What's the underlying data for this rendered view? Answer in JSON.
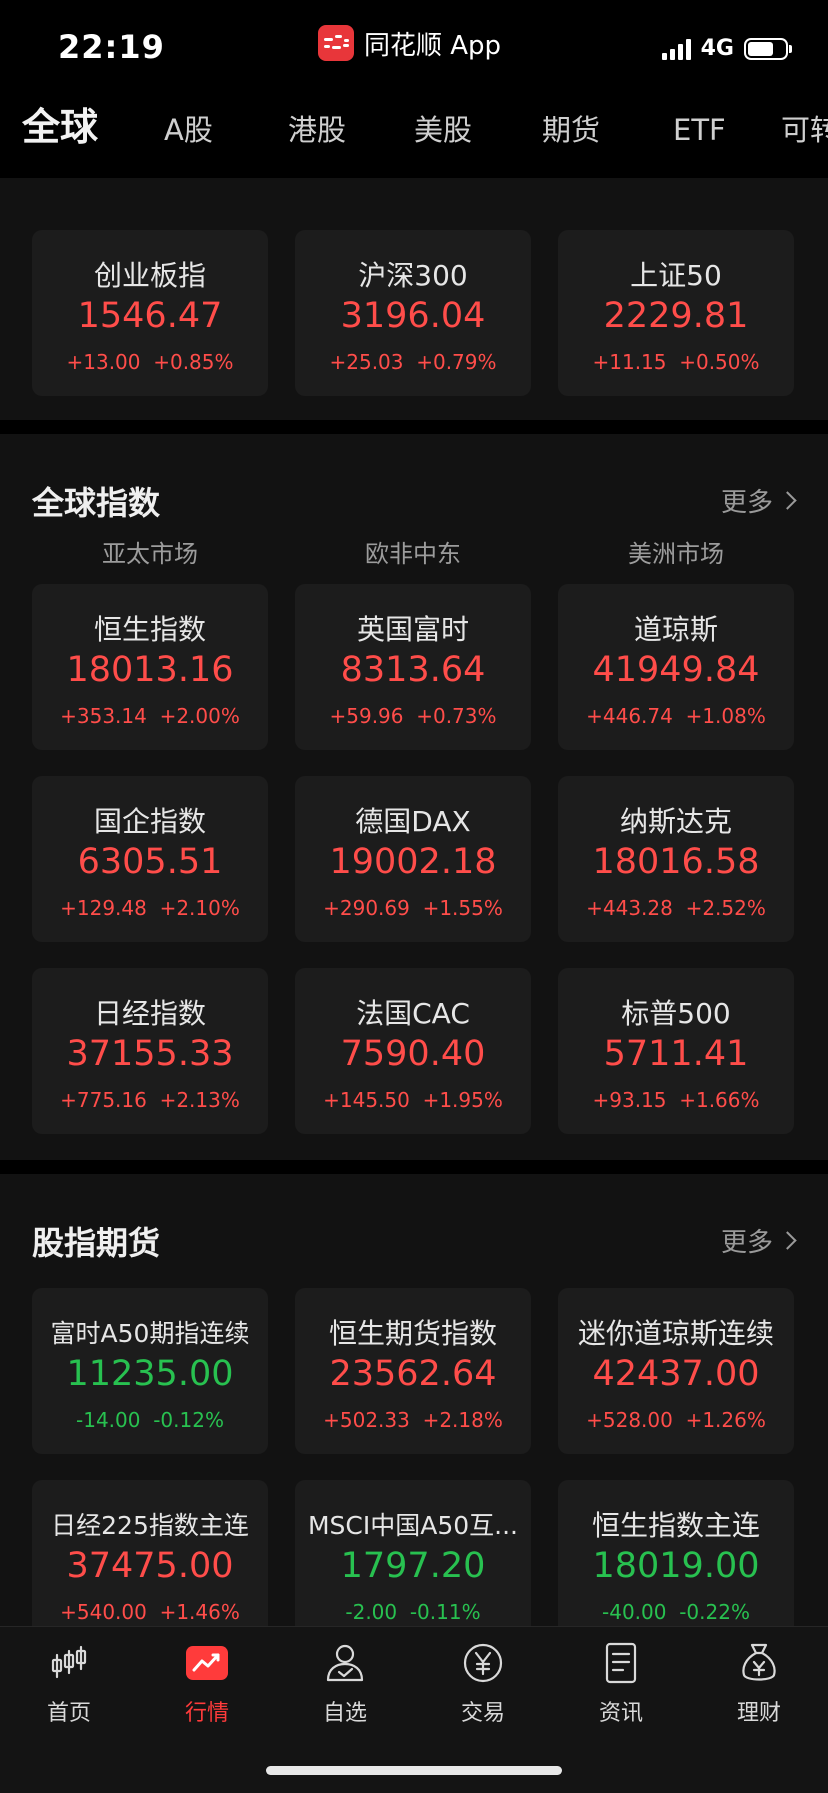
{
  "status_bar": {
    "time": "22:19",
    "app_name": "同花顺 App",
    "network": "4G",
    "battery_level": 0.7
  },
  "top_tabs": [
    "全球",
    "A股",
    "港股",
    "美股",
    "期货",
    "ETF",
    "可转"
  ],
  "a_share_indices": [
    {
      "name": "创业板指",
      "value": "1546.47",
      "change": "+13.00",
      "pct": "+0.85%",
      "trend": "up"
    },
    {
      "name": "沪深300",
      "value": "3196.04",
      "change": "+25.03",
      "pct": "+0.79%",
      "trend": "up"
    },
    {
      "name": "上证50",
      "value": "2229.81",
      "change": "+11.15",
      "pct": "+0.50%",
      "trend": "up"
    }
  ],
  "global_indices": {
    "title": "全球指数",
    "more": "更多",
    "regions": [
      "亚太市场",
      "欧非中东",
      "美洲市场"
    ],
    "cards": [
      {
        "name": "恒生指数",
        "value": "18013.16",
        "change": "+353.14",
        "pct": "+2.00%",
        "trend": "up"
      },
      {
        "name": "英国富时",
        "value": "8313.64",
        "change": "+59.96",
        "pct": "+0.73%",
        "trend": "up"
      },
      {
        "name": "道琼斯",
        "value": "41949.84",
        "change": "+446.74",
        "pct": "+1.08%",
        "trend": "up"
      },
      {
        "name": "国企指数",
        "value": "6305.51",
        "change": "+129.48",
        "pct": "+2.10%",
        "trend": "up"
      },
      {
        "name": "德国DAX",
        "value": "19002.18",
        "change": "+290.69",
        "pct": "+1.55%",
        "trend": "up"
      },
      {
        "name": "纳斯达克",
        "value": "18016.58",
        "change": "+443.28",
        "pct": "+2.52%",
        "trend": "up"
      },
      {
        "name": "日经指数",
        "value": "37155.33",
        "change": "+775.16",
        "pct": "+2.13%",
        "trend": "up"
      },
      {
        "name": "法国CAC",
        "value": "7590.40",
        "change": "+145.50",
        "pct": "+1.95%",
        "trend": "up"
      },
      {
        "name": "标普500",
        "value": "5711.41",
        "change": "+93.15",
        "pct": "+1.66%",
        "trend": "up"
      }
    ]
  },
  "index_futures": {
    "title": "股指期货",
    "more": "更多",
    "cards": [
      {
        "name": "富时A50期指连续",
        "value": "11235.00",
        "change": "-14.00",
        "pct": "-0.12%",
        "trend": "down"
      },
      {
        "name": "恒生期货指数",
        "value": "23562.64",
        "change": "+502.33",
        "pct": "+2.18%",
        "trend": "up"
      },
      {
        "name": "迷你道琼斯连续",
        "value": "42437.00",
        "change": "+528.00",
        "pct": "+1.26%",
        "trend": "up"
      },
      {
        "name": "日经225指数主连",
        "value": "37475.00",
        "change": "+540.00",
        "pct": "+1.46%",
        "trend": "up"
      },
      {
        "name": "MSCI中国A50互...",
        "value": "1797.20",
        "change": "-2.00",
        "pct": "-0.11%",
        "trend": "down"
      },
      {
        "name": "恒生指数主连",
        "value": "18019.00",
        "change": "-40.00",
        "pct": "-0.22%",
        "trend": "down"
      }
    ]
  },
  "bottom_tabs": [
    {
      "label": "首页",
      "icon": "candlestick-icon"
    },
    {
      "label": "行情",
      "icon": "market-chart-icon"
    },
    {
      "label": "自选",
      "icon": "watchlist-person-icon"
    },
    {
      "label": "交易",
      "icon": "yen-coin-icon"
    },
    {
      "label": "资讯",
      "icon": "news-document-icon"
    },
    {
      "label": "理财",
      "icon": "money-bag-icon"
    }
  ],
  "active_bottom_tab": "行情",
  "colors": {
    "up": "#ff4d4a",
    "down": "#28c150",
    "accent": "#e8363a",
    "background": "#000000",
    "card": "#1c1c1c"
  }
}
